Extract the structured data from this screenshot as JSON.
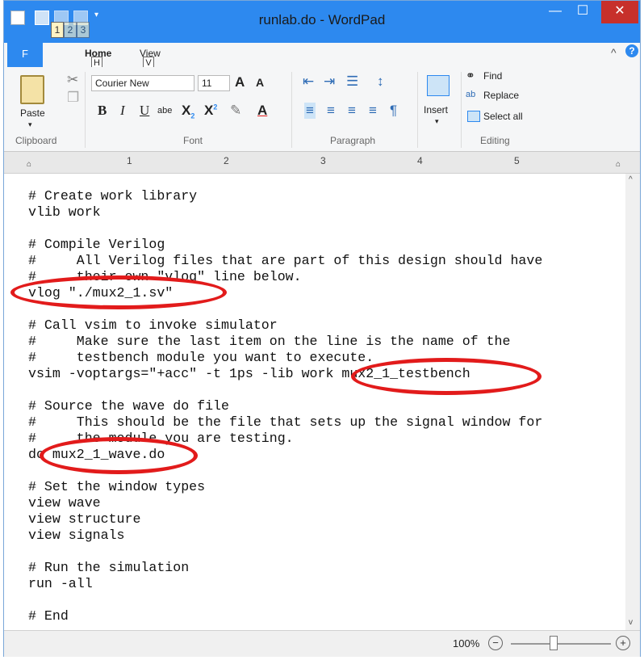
{
  "window": {
    "title": "runlab.do - WordPad",
    "qat_keytips": [
      "1",
      "2",
      "3"
    ],
    "controls": {
      "minimize": "—",
      "maximize": "☐",
      "close": "✕"
    }
  },
  "ribbon": {
    "file_tab": {
      "label": "F"
    },
    "tabs": [
      {
        "label": "Home",
        "keytip": "H"
      },
      {
        "label": "View",
        "keytip": "V"
      }
    ],
    "clipboard": {
      "label": "Clipboard",
      "paste_label": "Paste",
      "icons": [
        "paste-icon",
        "cut-icon",
        "copy-icon"
      ]
    },
    "font": {
      "label": "Font",
      "family": "Courier New",
      "size": "11",
      "grow_label": "A",
      "shrink_label": "A",
      "bold_label": "B",
      "italic_label": "I",
      "underline_label": "U",
      "strike_label": "abe",
      "sub_label": "X",
      "sub_mark": "2",
      "sup_label": "X",
      "sup_mark": "2",
      "color_label": "A"
    },
    "paragraph": {
      "label": "Paragraph"
    },
    "insert": {
      "label": "Insert"
    },
    "editing": {
      "label": "Editing",
      "find_label": "Find",
      "replace_label": "Replace",
      "select_all_label": "Select all"
    }
  },
  "ruler": {
    "numbers": [
      "1",
      "2",
      "3",
      "4",
      "5"
    ]
  },
  "document": {
    "lines": [
      "# Create work library",
      "vlib work",
      "",
      "# Compile Verilog",
      "#     All Verilog files that are part of this design should have",
      "#     their own \"vlog\" line below.",
      "vlog \"./mux2_1.sv\"",
      "",
      "# Call vsim to invoke simulator",
      "#     Make sure the last item on the line is the name of the",
      "#     testbench module you want to execute.",
      "vsim -voptargs=\"+acc\" -t 1ps -lib work mux2_1_testbench",
      "",
      "# Source the wave do file",
      "#     This should be the file that sets up the signal window for",
      "#     the module you are testing.",
      "do mux2_1_wave.do",
      "",
      "# Set the window types",
      "view wave",
      "view structure",
      "view signals",
      "",
      "# Run the simulation",
      "run -all",
      "",
      "# End"
    ],
    "highlight_color": "#e21b1b"
  },
  "status": {
    "zoom": "100%",
    "zoom_out_label": "−",
    "zoom_in_label": "+"
  },
  "colors": {
    "title_bar": "#2d89ef",
    "close_button": "#c7302b"
  }
}
